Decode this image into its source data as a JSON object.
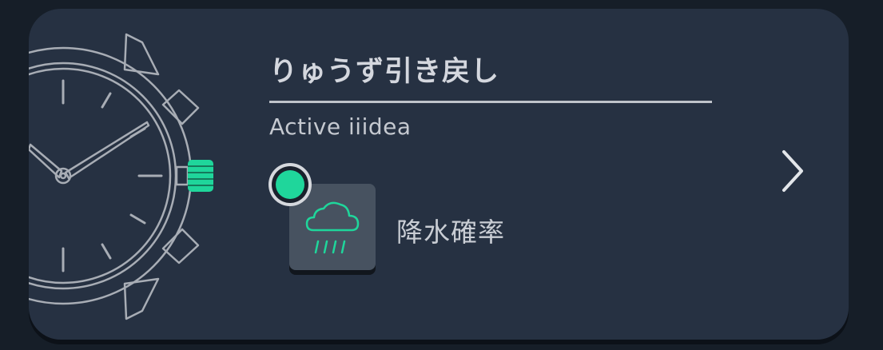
{
  "card": {
    "title": "りゅうず引き戻し",
    "subtitle": "Active iiidea",
    "feature": {
      "label": "降水確率",
      "icon": "rain-cloud-icon",
      "indicator_color": "#1fd69b"
    },
    "icons": {
      "watch": "watch-icon",
      "crown": "watch-crown-icon",
      "next": "chevron-right-icon"
    },
    "colors": {
      "accent": "#1fd69b",
      "card_bg": "#263142",
      "page_bg": "#161e28"
    }
  }
}
